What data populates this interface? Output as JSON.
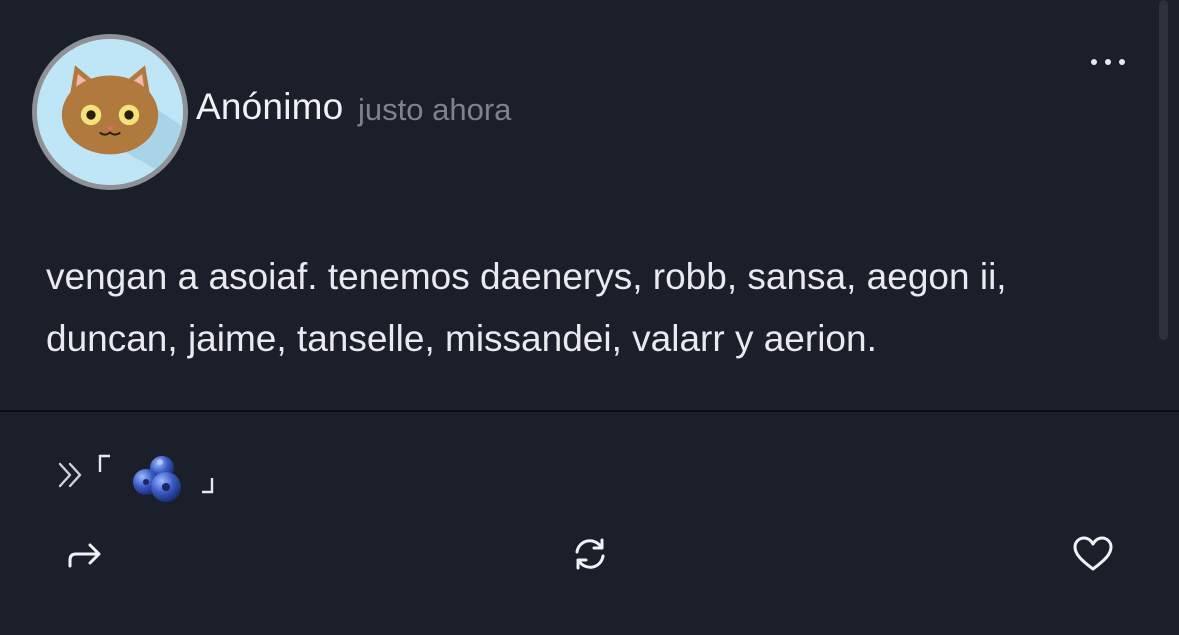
{
  "post": {
    "author": "Anónimo",
    "timestamp": "justo ahora",
    "text": "vengan a asoiaf. tenemos daenerys, robb, sansa, aegon ii, duncan, jaime, tanselle, missandei, valarr y aerion.",
    "more_icon": "more-horizontal-icon"
  },
  "tag_line": {
    "prefix_icon": "double-chevron-right-icon",
    "open_bracket": "「",
    "emoji_icon": "blueberries-icon",
    "close_bracket": "」"
  },
  "actions": {
    "share_icon": "share-arrow-icon",
    "reblog_icon": "reblog-icon",
    "like_icon": "heart-icon"
  },
  "colors": {
    "background": "#1b1f29",
    "text": "#e8eaef",
    "muted": "#7d828d"
  }
}
